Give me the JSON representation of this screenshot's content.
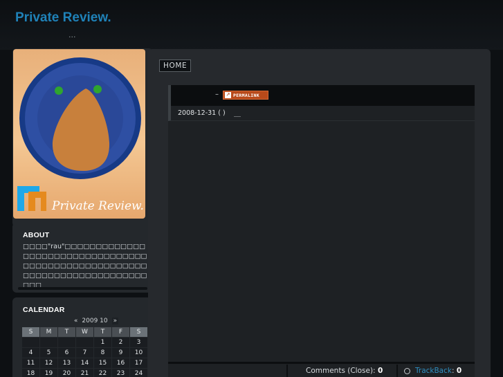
{
  "site": {
    "title": "Private Review.",
    "description": "..."
  },
  "logo": {
    "alt_text": "Private Review.",
    "badge_letters": "PR"
  },
  "about": {
    "title": "ABOUT",
    "text": "□□□□\"rau\"□□□□□□□□□□□□□□□□□□□□□□□□□□□□□□□□□□□□□□□□□□□□□□□□□□□□□□□□□□□□□□□□□□□□□□□□□□□□"
  },
  "calendar": {
    "title": "CALENDAR",
    "prev": "«",
    "month": "2009 10",
    "next": "»",
    "weekdays": [
      "S",
      "M",
      "T",
      "W",
      "T",
      "F",
      "S"
    ],
    "weeks": [
      [
        "",
        "",
        "",
        "",
        "1",
        "2",
        "3"
      ],
      [
        "4",
        "5",
        "6",
        "7",
        "8",
        "9",
        "10"
      ],
      [
        "11",
        "12",
        "13",
        "14",
        "15",
        "16",
        "17"
      ],
      [
        "18",
        "19",
        "20",
        "21",
        "22",
        "23",
        "24"
      ]
    ]
  },
  "nav": {
    "home_label": "HOME"
  },
  "entry": {
    "title_dash": "–",
    "permalink_label": "PERMALINK",
    "date": "2008-12-31 ( )",
    "meta_mark": "＿",
    "comments_label": "Comments (Close): ",
    "comments_count": "0",
    "trackback_label": "TrackBack",
    "trackback_sep": ": ",
    "trackback_count": "0"
  },
  "colors": {
    "background": "#0d1013",
    "panel": "#26292d",
    "title_blue": "#1f82b8",
    "permalink_orange": "#b84a1a",
    "plate_blue": "#2e4fa3"
  }
}
